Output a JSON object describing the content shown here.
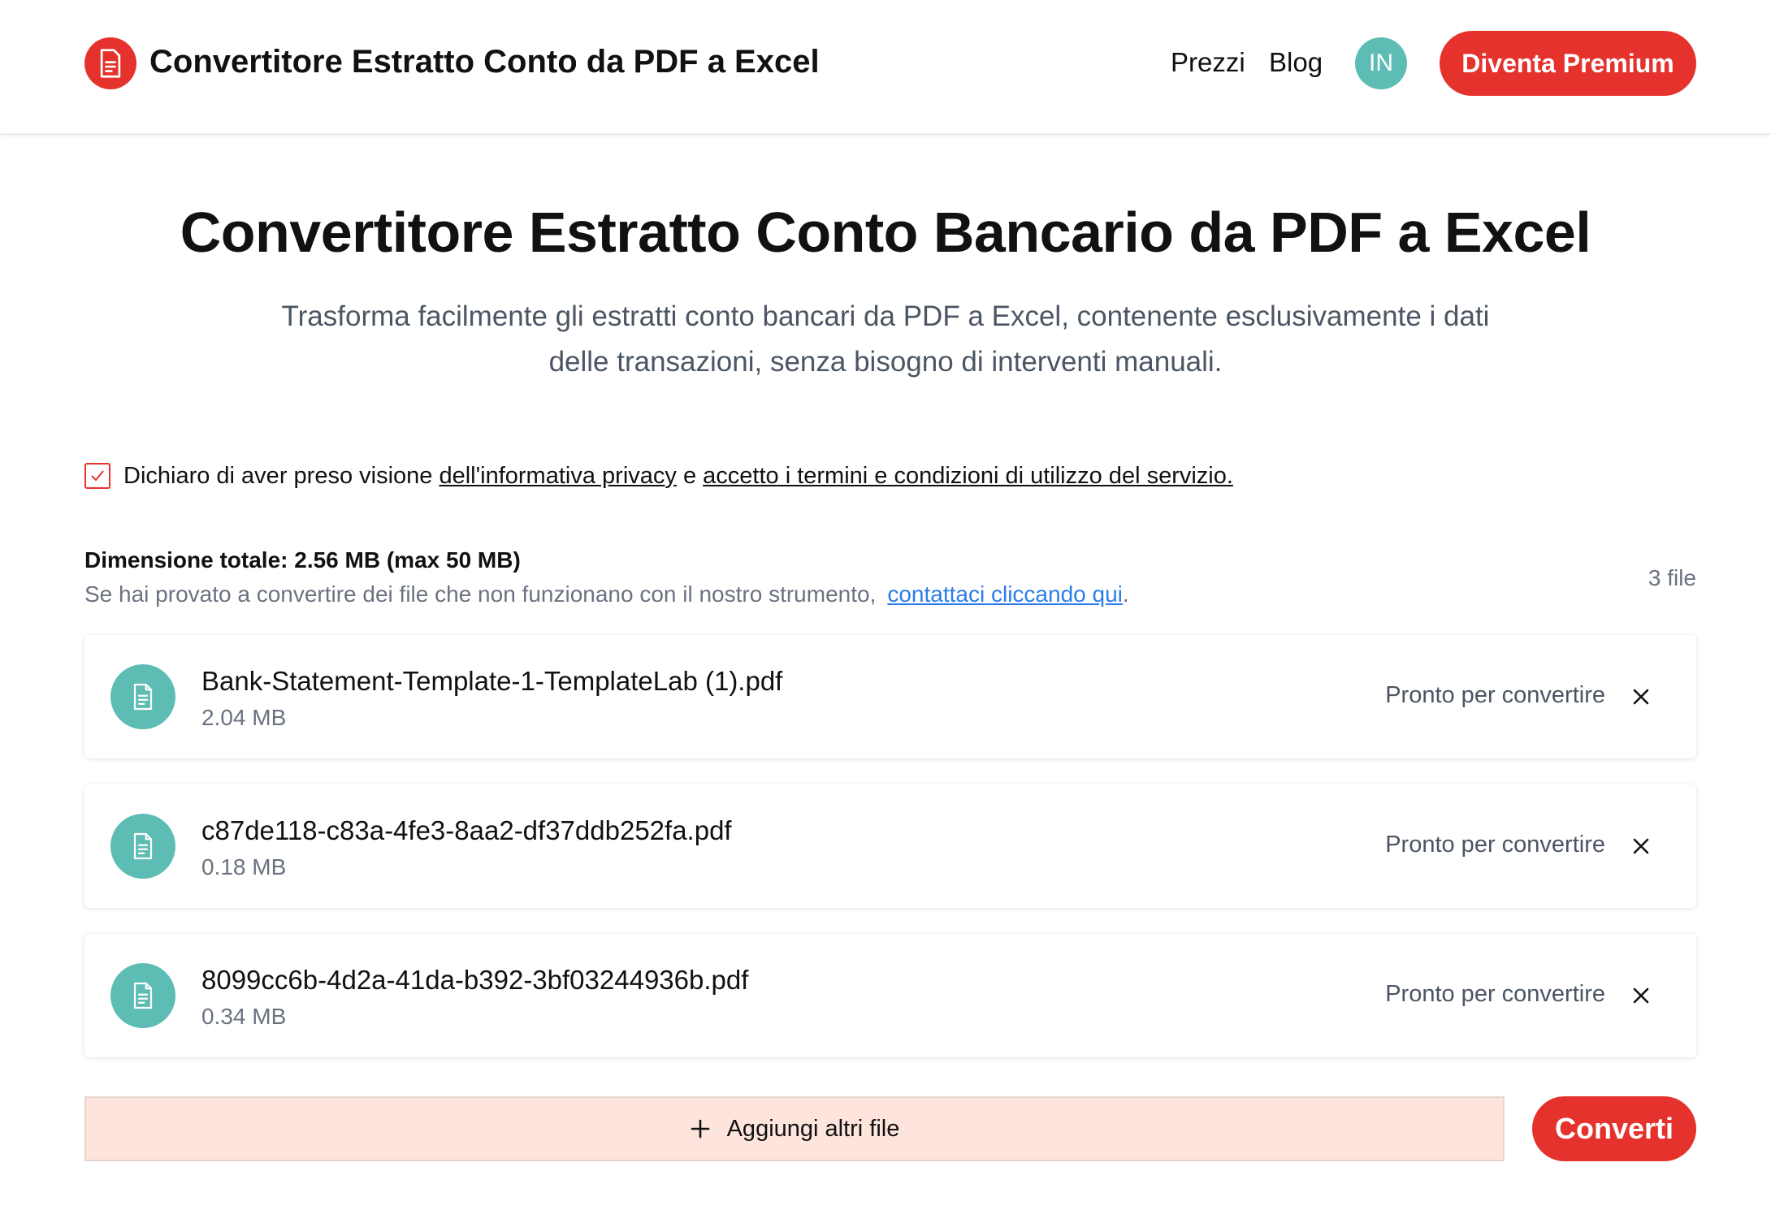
{
  "header": {
    "brand": "Convertitore Estratto Conto da PDF a Excel",
    "logo_icon": "document-icon",
    "nav": [
      {
        "label": "Prezzi"
      },
      {
        "label": "Blog"
      }
    ],
    "avatar_initials": "IN",
    "premium_label": "Diventa Premium"
  },
  "hero": {
    "title": "Convertitore Estratto Conto Bancario da PDF a Excel",
    "subtitle": "Trasforma facilmente gli estratti conto bancari da PDF a Excel, contenente esclusivamente i dati delle transazioni, senza bisogno di interventi manuali."
  },
  "consent": {
    "checked": true,
    "prefix": "Dichiaro di aver preso visione ",
    "privacy_link": "dell'informativa privacy",
    "middle": " e ",
    "terms_link": "accetto i termini e condizioni di utilizzo del servizio."
  },
  "upload": {
    "total_size": "Dimensione totale: 2.56 MB (max 50 MB)",
    "help_text": "Se hai provato a convertire dei file che non funzionano con il nostro strumento,",
    "help_link": "contattaci cliccando qui",
    "help_suffix": ".",
    "file_count": "3 file",
    "files": [
      {
        "name": "Bank-Statement-Template-1-TemplateLab (1).pdf",
        "size": "2.04 MB",
        "status": "Pronto per convertire"
      },
      {
        "name": "c87de118-c83a-4fe3-8aa2-df37ddb252fa.pdf",
        "size": "0.18 MB",
        "status": "Pronto per convertire"
      },
      {
        "name": "8099cc6b-4d2a-41da-b392-3bf03244936b.pdf",
        "size": "0.34 MB",
        "status": "Pronto per convertire"
      }
    ],
    "add_files_label": "Aggiungi altri file",
    "convert_label": "Converti"
  },
  "colors": {
    "accent": "#e5322d",
    "teal": "#5dbdb4",
    "link": "#2b7de9",
    "add_bg": "#fde4dc"
  }
}
